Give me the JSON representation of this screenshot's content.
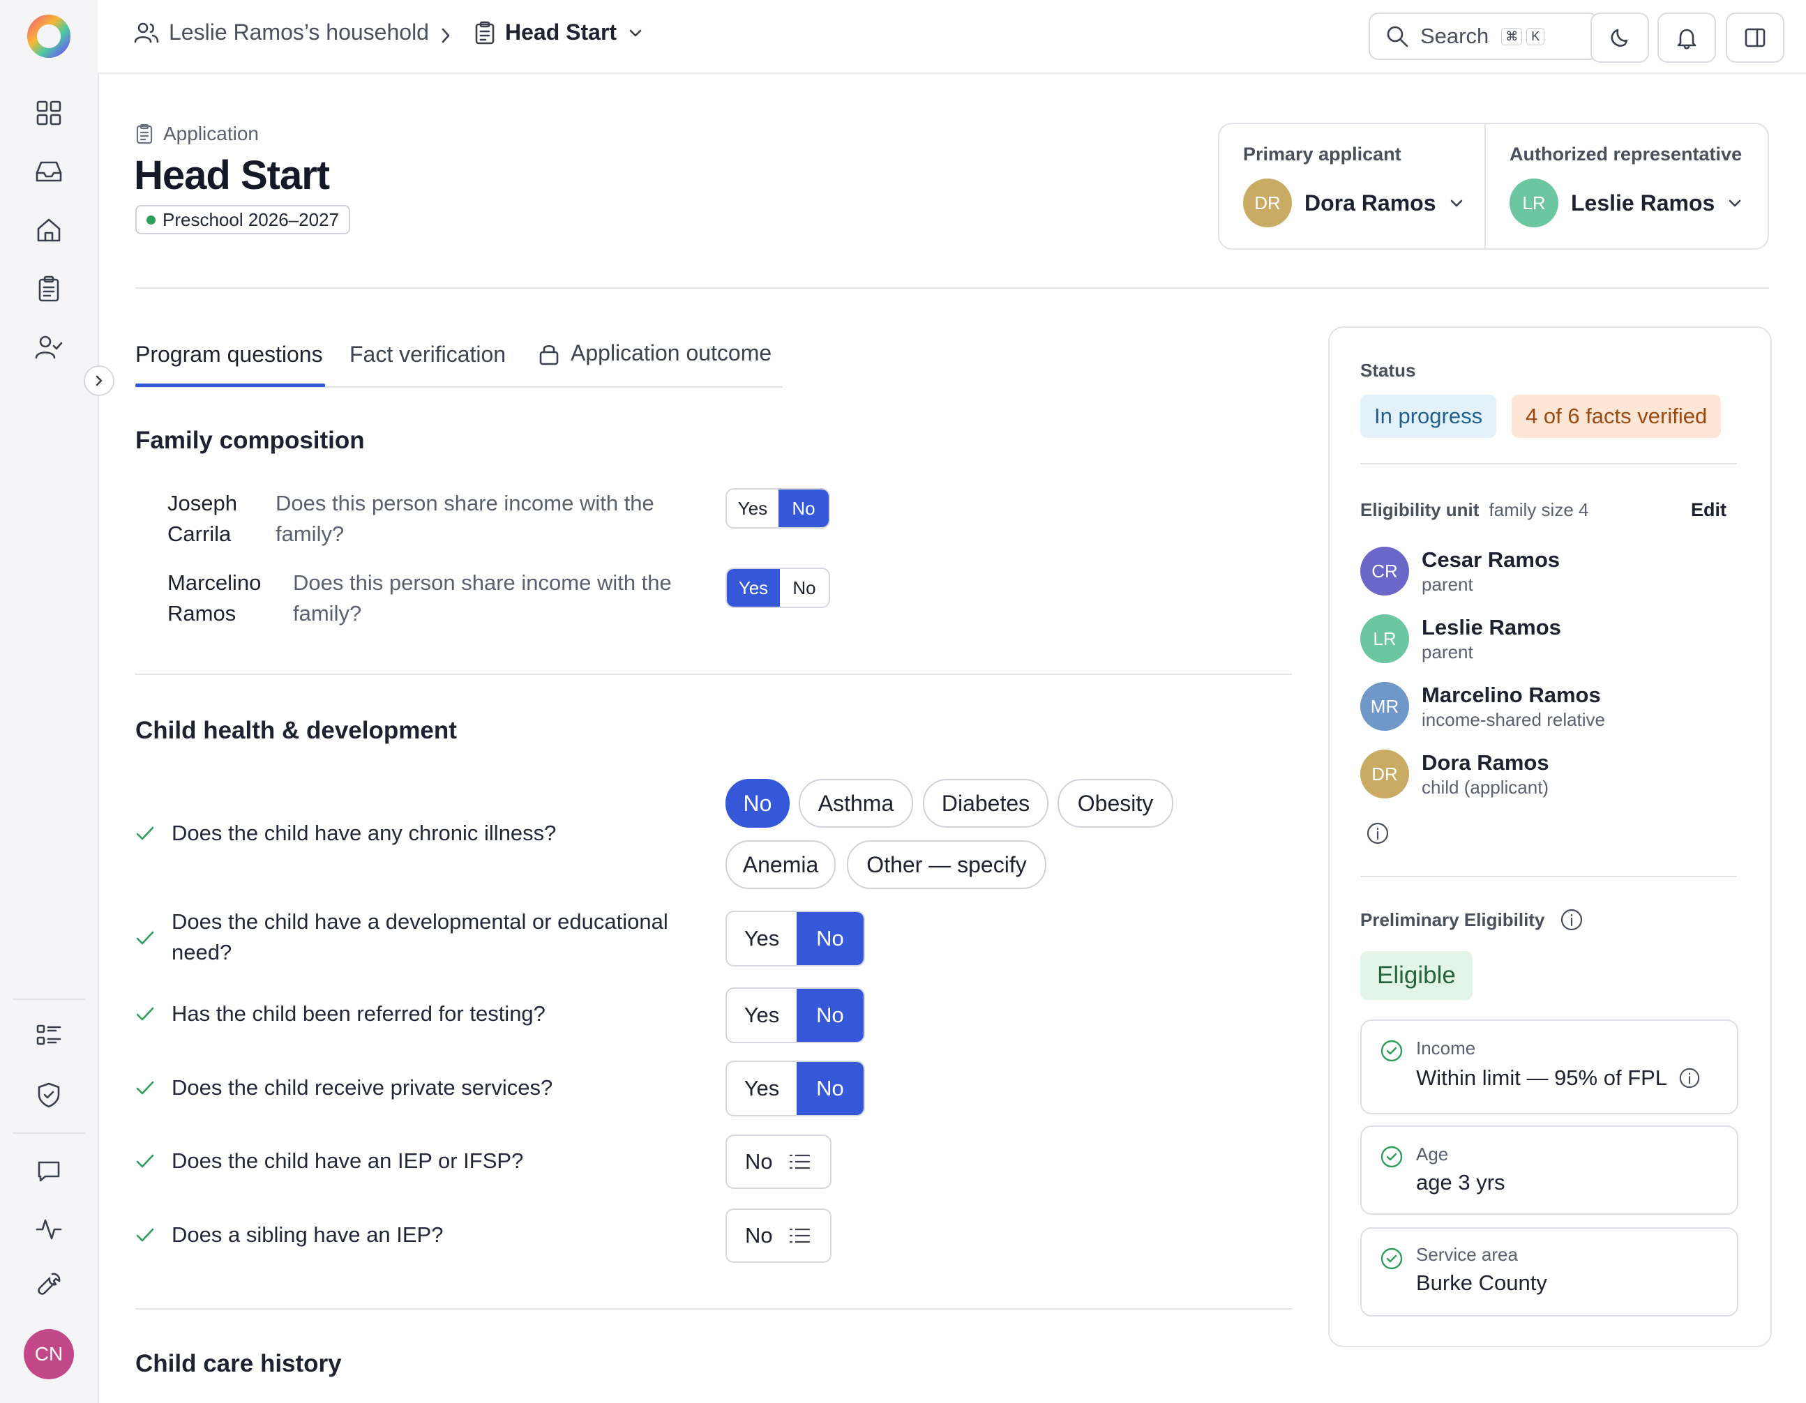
{
  "sidebar": {
    "user_initials": "CN",
    "items": [
      {
        "name": "dashboard",
        "icon": "grid-icon"
      },
      {
        "name": "inbox",
        "icon": "inbox-icon"
      },
      {
        "name": "households",
        "icon": "home-icon"
      },
      {
        "name": "applications",
        "icon": "clipboard-icon"
      },
      {
        "name": "clients",
        "icon": "user-check-icon"
      },
      {
        "name": "programs",
        "icon": "list-icon"
      },
      {
        "name": "compliance",
        "icon": "shield-check-icon"
      },
      {
        "name": "messages",
        "icon": "chat-icon"
      },
      {
        "name": "activity",
        "icon": "activity-icon"
      },
      {
        "name": "tools",
        "icon": "wrench-icon"
      }
    ]
  },
  "topbar": {
    "household": "Leslie Ramos’s household",
    "program": "Head Start",
    "search_label": "Search",
    "shortcut_mod": "⌘",
    "shortcut_key": "K"
  },
  "header": {
    "eyebrow": "Application",
    "title": "Head Start",
    "badge": "Preschool 2026–2027",
    "primary_label": "Primary applicant",
    "primary_initials": "DR",
    "primary_name": "Dora Ramos",
    "rep_label": "Authorized representative",
    "rep_initials": "LR",
    "rep_name": "Leslie Ramos"
  },
  "tabs": {
    "program": "Program questions",
    "facts": "Fact verification",
    "outcome": "Application outcome"
  },
  "family": {
    "heading": "Family composition",
    "rows": [
      {
        "name_line1": "Joseph",
        "name_line2": "Carrila",
        "q_line1": "Does this person share income with the",
        "q_line2": "family?",
        "yes": "Yes",
        "no": "No"
      },
      {
        "name_line1": "Marcelino",
        "name_line2": "Ramos",
        "q_line1": "Does this person share income with the",
        "q_line2": "family?",
        "yes": "Yes",
        "no": "No"
      }
    ]
  },
  "health": {
    "heading": "Child health & development",
    "chronic_q": "Does the child have any chronic illness?",
    "chronic_options": [
      "No",
      "Asthma",
      "Diabetes",
      "Obesity",
      "Anemia",
      "Other — specify"
    ],
    "dev_q_line1": "Does the child have a developmental or educational",
    "dev_q_line2": "need?",
    "referred_q": "Has the child been referred for testing?",
    "private_q": "Does the child receive private services?",
    "iep_q": "Does the child have an IEP or IFSP?",
    "sibling_q": "Does a sibling have an IEP?",
    "yes": "Yes",
    "no": "No"
  },
  "next_section": "Child care history",
  "status": {
    "label": "Status",
    "state": "In progress",
    "facts": "4 of 6 facts verified",
    "unit_label": "Eligibility unit",
    "unit_size": "family size 4",
    "edit": "Edit",
    "members": [
      {
        "initials": "CR",
        "name": "Cesar Ramos",
        "role": "parent"
      },
      {
        "initials": "LR",
        "name": "Leslie Ramos",
        "role": "parent"
      },
      {
        "initials": "MR",
        "name": "Marcelino Ramos",
        "role": "income-shared relative"
      },
      {
        "initials": "DR",
        "name": "Dora Ramos",
        "role": "child (applicant)"
      }
    ],
    "prelim_label": "Preliminary Eligibility",
    "prelim_value": "Eligible",
    "criteria": [
      {
        "label": "Income",
        "value": "Within limit — 95% of FPL"
      },
      {
        "label": "Age",
        "value": "age 3 yrs"
      },
      {
        "label": "Service area",
        "value": "Burke County"
      }
    ]
  },
  "colors": {
    "accent": "#3458d8",
    "success": "#2e9e5b",
    "in_progress_bg": "#e3f1fb",
    "facts_bg": "#fde6d5",
    "eligible_bg": "#e3f5e7"
  }
}
